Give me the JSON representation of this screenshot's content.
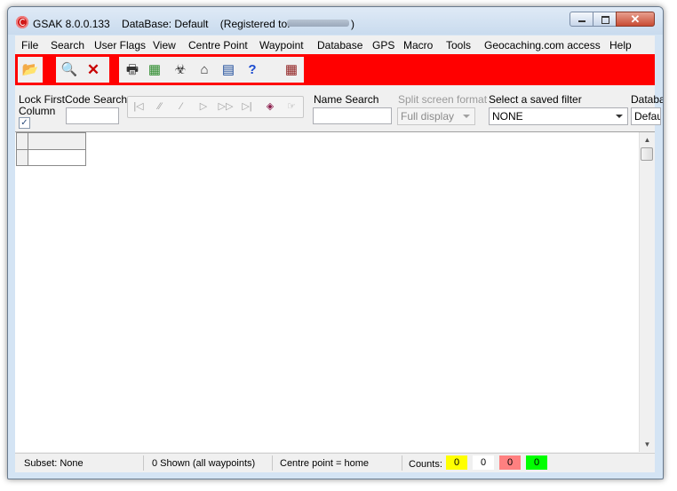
{
  "window": {
    "title": "GSAK 8.0.0.133    DataBase: Default    (Registered to:",
    "title_close": ")",
    "minimize_label": "",
    "maximize_label": "",
    "close_label": "✕"
  },
  "menu": [
    "File",
    "Search",
    "User Flags",
    "View",
    "Centre Point",
    "Waypoint",
    "Database",
    "GPS",
    "Macro",
    "Tools",
    "Geocaching.com access",
    "Help"
  ],
  "toolbar": {
    "accent": "#ff0000",
    "buttons": [
      "open-folder-icon",
      "preview-icon",
      "delete-icon",
      "print-icon",
      "grid-colors-icon",
      "signpost-icon",
      "home-icon",
      "window-icon",
      "help-icon",
      "exit-icon"
    ]
  },
  "filters": {
    "lock_first_column_label_1": "Lock First",
    "lock_first_column_label_2": "Column",
    "lock_checked": "✓",
    "code_search_label": "Code Search",
    "code_search_value": "",
    "name_search_label": "Name Search",
    "name_search_value": "",
    "split_screen_label": "Split screen format",
    "split_screen_value": "Full display",
    "saved_filter_label": "Select a saved filter",
    "saved_filter_value": "NONE",
    "database_label": "Databa",
    "database_value": "Defau"
  },
  "nav_icons": [
    "first-record-icon",
    "previous-page-icon",
    "previous-record-icon",
    "next-record-icon",
    "next-page-icon",
    "last-record-icon",
    "erase-icon",
    "pointer-icon"
  ],
  "nav_glyphs": [
    "|◁",
    "⁄⁄",
    "⁄",
    "▷",
    "▷▷",
    "▷|",
    "◈",
    "☞"
  ],
  "status": {
    "subset": "Subset: None",
    "shown": "0 Shown (all waypoints)",
    "centre": "Centre point = home",
    "counts_label": "Counts:",
    "counts": [
      {
        "value": "0",
        "color": "#ffff00"
      },
      {
        "value": "0",
        "color": "#ffffff"
      },
      {
        "value": "0",
        "color": "#ff8080"
      },
      {
        "value": "0",
        "color": "#00ff00"
      }
    ]
  }
}
